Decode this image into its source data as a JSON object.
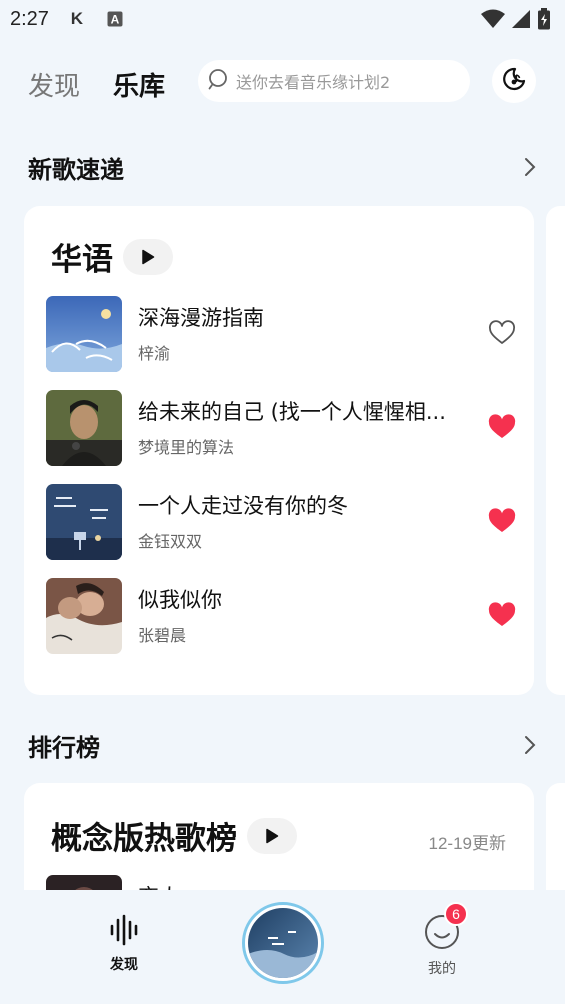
{
  "status_bar": {
    "time": "2:27",
    "app_icons": [
      "k-icon",
      "a-icon"
    ]
  },
  "header": {
    "tabs": [
      {
        "label": "发现",
        "active": false
      },
      {
        "label": "乐库",
        "active": true
      }
    ],
    "search": {
      "placeholder": "送你去看音乐缘计划2"
    }
  },
  "new_songs": {
    "title": "新歌速递",
    "card": {
      "title": "华语",
      "songs": [
        {
          "title": "深海漫游指南",
          "artist": "梓渝",
          "liked": false
        },
        {
          "title": "给未来的自己 (找一个人惺惺相...",
          "artist": "梦境里的算法",
          "liked": true
        },
        {
          "title": "一个人走过没有你的冬",
          "artist": "金钰双双",
          "liked": true
        },
        {
          "title": "似我似你",
          "artist": "张碧晨",
          "liked": true
        }
      ]
    }
  },
  "charts": {
    "title": "排行榜",
    "card": {
      "title": "概念版热歌榜",
      "update": "12-19更新",
      "songs": [
        {
          "title": "恋人"
        }
      ]
    }
  },
  "bottom_nav": {
    "discover_label": "发现",
    "mine_label": "我的",
    "badge_count": "6"
  },
  "colors": {
    "accent_red": "#f5314f",
    "background": "#f1f6fb",
    "player_ring": "#7fc8ea"
  }
}
